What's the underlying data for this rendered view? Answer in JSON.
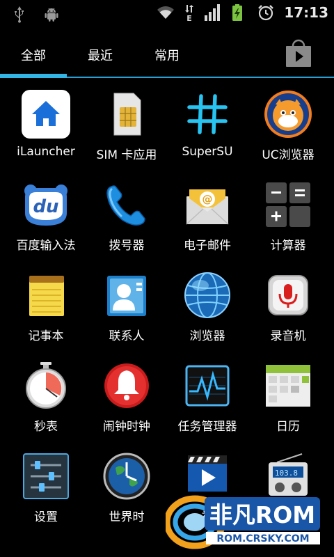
{
  "status_bar": {
    "time": "17:13",
    "icons": [
      "usb-icon",
      "android-debug-icon",
      "wifi-icon",
      "edge-network-icon",
      "signal-icon",
      "battery-charging-icon",
      "alarm-icon"
    ]
  },
  "tabs": [
    {
      "label": "全部",
      "selected": true
    },
    {
      "label": "最近",
      "selected": false
    },
    {
      "label": "常用",
      "selected": false
    }
  ],
  "store_button_icon": "play-store-icon",
  "apps": [
    {
      "label": "iLauncher",
      "icon": "home-icon"
    },
    {
      "label": "SIM 卡应用",
      "icon": "sim-card-icon"
    },
    {
      "label": "SuperSU",
      "icon": "hash-icon"
    },
    {
      "label": "UC浏览器",
      "icon": "uc-browser-icon"
    },
    {
      "label": "百度输入法",
      "icon": "baidu-input-icon"
    },
    {
      "label": "拨号器",
      "icon": "phone-icon"
    },
    {
      "label": "电子邮件",
      "icon": "email-icon"
    },
    {
      "label": "计算器",
      "icon": "calculator-icon"
    },
    {
      "label": "记事本",
      "icon": "notepad-icon"
    },
    {
      "label": "联系人",
      "icon": "contacts-icon"
    },
    {
      "label": "浏览器",
      "icon": "globe-icon"
    },
    {
      "label": "录音机",
      "icon": "microphone-icon"
    },
    {
      "label": "秒表",
      "icon": "stopwatch-icon"
    },
    {
      "label": "闹钟时钟",
      "icon": "alarm-bell-icon"
    },
    {
      "label": "任务管理器",
      "icon": "task-manager-icon"
    },
    {
      "label": "日历",
      "icon": "calendar-icon"
    },
    {
      "label": "设置",
      "icon": "settings-sliders-icon"
    },
    {
      "label": "世界时",
      "icon": "world-clock-icon"
    },
    {
      "label": "视",
      "icon": "video-player-icon"
    },
    {
      "label": "",
      "icon": "radio-icon"
    }
  ],
  "watermark": {
    "brand": "非凡ROM",
    "url": "ROM.CRSKY.COM"
  },
  "colors": {
    "accent": "#33b5e5",
    "background": "#000000"
  }
}
